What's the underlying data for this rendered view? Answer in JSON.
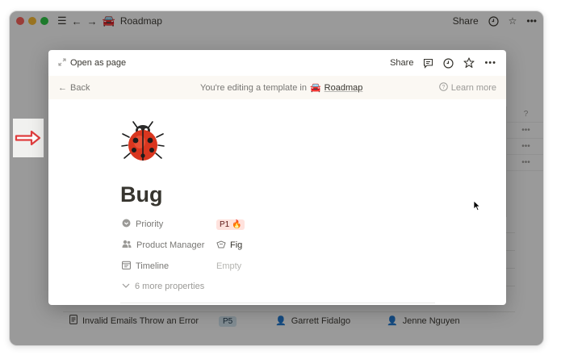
{
  "window": {
    "title": "Roadmap",
    "share_label": "Share"
  },
  "background_table": {
    "visible_row": {
      "title": "Invalid Emails Throw an Error",
      "priority": "P5",
      "owner": "Garrett Fidalgo",
      "assignee": "Jenne Nguyen"
    }
  },
  "modal": {
    "open_as_page_label": "Open as page",
    "share_label": "Share",
    "banner": {
      "back_label": "Back",
      "editing_text": "You're editing a template in",
      "roadmap_label": "Roadmap",
      "learn_more_label": "Learn more"
    },
    "page": {
      "icon": "ladybug-emoji",
      "title": "Bug",
      "properties": [
        {
          "name": "Priority",
          "icon": "priority-icon",
          "value": "P1 🔥"
        },
        {
          "name": "Product Manager",
          "icon": "people-icon",
          "value": "Fig"
        },
        {
          "name": "Timeline",
          "icon": "calendar-icon",
          "value": "Empty"
        }
      ],
      "more_properties_label": "6 more properties"
    }
  },
  "colors": {
    "overlay": "#0f0f0f",
    "text": "#37352f",
    "muted": "#787774",
    "banner_bg": "#fbf8f3",
    "p1_tag_bg": "#ffe2dd",
    "arrow": "#e03e3e"
  }
}
